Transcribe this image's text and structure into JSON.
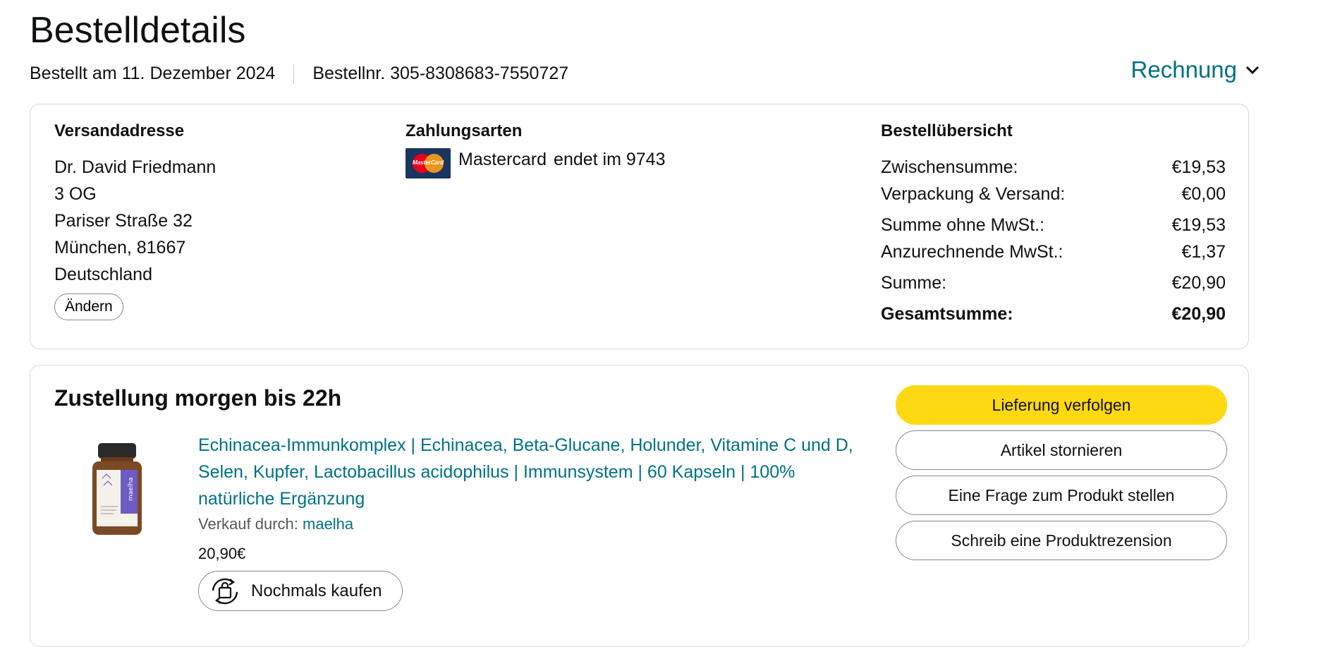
{
  "header": {
    "title": "Bestelldetails",
    "ordered_on": "Bestellt am 11. Dezember 2024",
    "order_number": "Bestellnr. 305-8308683-7550727",
    "invoice_label": "Rechnung"
  },
  "shipping": {
    "title": "Versandadresse",
    "lines": [
      "Dr. David Friedmann",
      "3 OG",
      "Pariser Straße 32",
      "München, 81667",
      "Deutschland"
    ],
    "change_label": "Ändern"
  },
  "payment": {
    "title": "Zahlungsarten",
    "card_brand": "Mastercard",
    "card_suffix": "endet im 9743",
    "logo_text": "MasterCard"
  },
  "summary": {
    "title": "Bestellübersicht",
    "rows": [
      {
        "label": "Zwischensumme:",
        "value": "€19,53"
      },
      {
        "label": "Verpackung & Versand:",
        "value": "€0,00"
      },
      {
        "label": "Summe ohne MwSt.:",
        "value": "€19,53"
      },
      {
        "label": "Anzurechnende MwSt.:",
        "value": "€1,37"
      },
      {
        "label": "Summe:",
        "value": "€20,90"
      },
      {
        "label": "Gesamtsumme:",
        "value": "€20,90"
      }
    ]
  },
  "delivery": {
    "title": "Zustellung morgen bis 22h",
    "product_title": "Echinacea-Immunkomplex | Echinacea, Beta-Glucane, Holunder, Vitamine C und D, Selen, Kupfer, Lactobacillus acidophilus | Immunsystem | 60 Kapseln | 100% natürliche Ergänzung",
    "seller_prefix": "Verkauf durch:",
    "seller_name": "maelha",
    "price": "20,90€",
    "buy_again_label": "Nochmals kaufen",
    "actions": {
      "track": "Lieferung verfolgen",
      "cancel": "Artikel stornieren",
      "question": "Eine Frage zum Produkt stellen",
      "review": "Schreib eine Produktrezension"
    }
  },
  "colors": {
    "link": "#007185",
    "primary_button": "#ffd814",
    "border": "#d5d9d9",
    "text": "#0f1111"
  }
}
